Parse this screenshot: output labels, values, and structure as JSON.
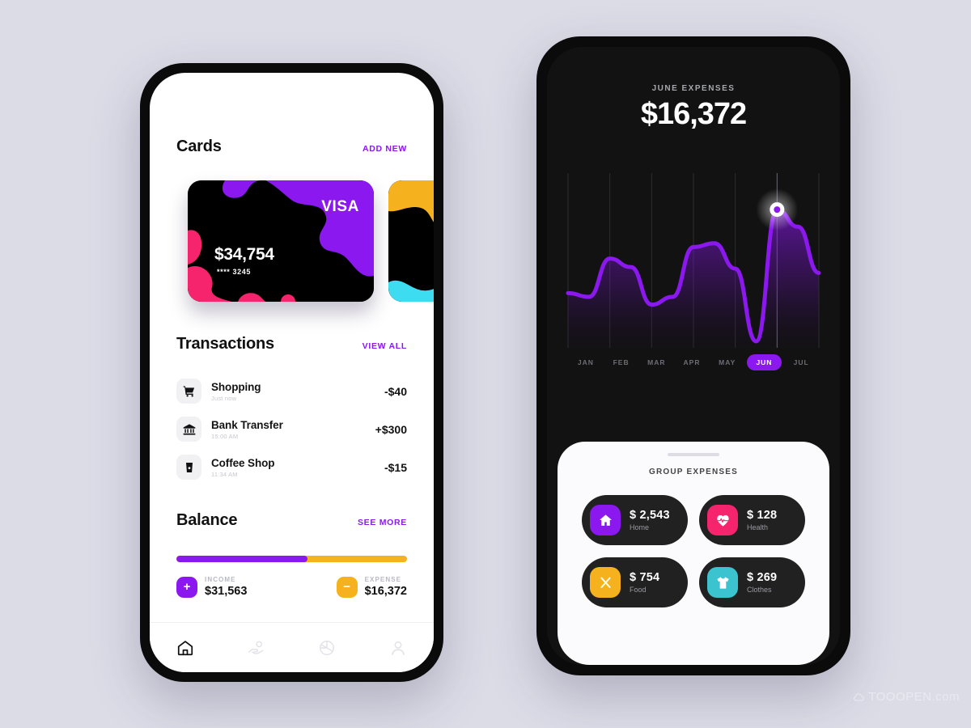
{
  "background_color": "#dcdce7",
  "accent_purple": "#8b18ee",
  "accent_amber": "#f5b21e",
  "accent_pink": "#f5246c",
  "accent_cyan": "#3edcf0",
  "left_phone": {
    "cards_section": {
      "title": "Cards",
      "action_label": "ADD NEW",
      "cards": [
        {
          "brand": "VISA",
          "amount": "$34,754",
          "masked_number": "**** 3245"
        },
        {
          "brand": "",
          "amount": "",
          "masked_number": ""
        }
      ]
    },
    "transactions_section": {
      "title": "Transactions",
      "action_label": "VIEW ALL",
      "items": [
        {
          "icon": "shopping-cart-icon",
          "name": "Shopping",
          "time": "Just now",
          "amount": "-$40"
        },
        {
          "icon": "bank-icon",
          "name": "Bank Transfer",
          "time": "15:00 AM",
          "amount": "+$300"
        },
        {
          "icon": "coffee-cup-icon",
          "name": "Coffee Shop",
          "time": "11:34 AM",
          "amount": "-$15"
        }
      ]
    },
    "balance_section": {
      "title": "Balance",
      "action_label": "SEE MORE",
      "progress_percent": 57,
      "income": {
        "badge": "+",
        "label": "INCOME",
        "value": "$31,563"
      },
      "expense": {
        "badge": "−",
        "label": "EXPENSE",
        "value": "$16,372"
      }
    },
    "bottom_nav": [
      {
        "icon": "home-icon",
        "active": true
      },
      {
        "icon": "hand-coin-icon",
        "active": false
      },
      {
        "icon": "pie-chart-icon",
        "active": false
      },
      {
        "icon": "person-icon",
        "active": false
      }
    ]
  },
  "right_phone": {
    "header": {
      "label": "JUNE EXPENSES",
      "total": "$16,372"
    },
    "selected_month": "JUN",
    "sheet": {
      "title": "GROUP EXPENSES",
      "cards": [
        {
          "icon": "home-icon",
          "icon_color": "#8b18ee",
          "amount": "$ 2,543",
          "category": "Home"
        },
        {
          "icon": "heartbeat-icon",
          "icon_color": "#f5246c",
          "amount": "$ 128",
          "category": "Health"
        },
        {
          "icon": "cutlery-icon",
          "icon_color": "#f5b21e",
          "amount": "$ 754",
          "category": "Food"
        },
        {
          "icon": "tshirt-icon",
          "icon_color": "#3bc3cf",
          "amount": "$ 269",
          "category": "Clothes"
        }
      ]
    }
  },
  "chart_data": {
    "type": "area",
    "title": "JUNE EXPENSES",
    "categories": [
      "JAN",
      "FEB",
      "MAR",
      "APR",
      "MAY",
      "JUN",
      "JUL"
    ],
    "values": [
      38,
      62,
      30,
      70,
      55,
      96,
      52
    ],
    "highlight_index": 5,
    "line_color": "#8b18ee",
    "grid": true,
    "legend": "none",
    "xlabel": "",
    "ylabel": "",
    "ylim": [
      0,
      100
    ]
  },
  "watermark": {
    "text": "TOOOPEN.com",
    "icon": "cloud-icon"
  }
}
